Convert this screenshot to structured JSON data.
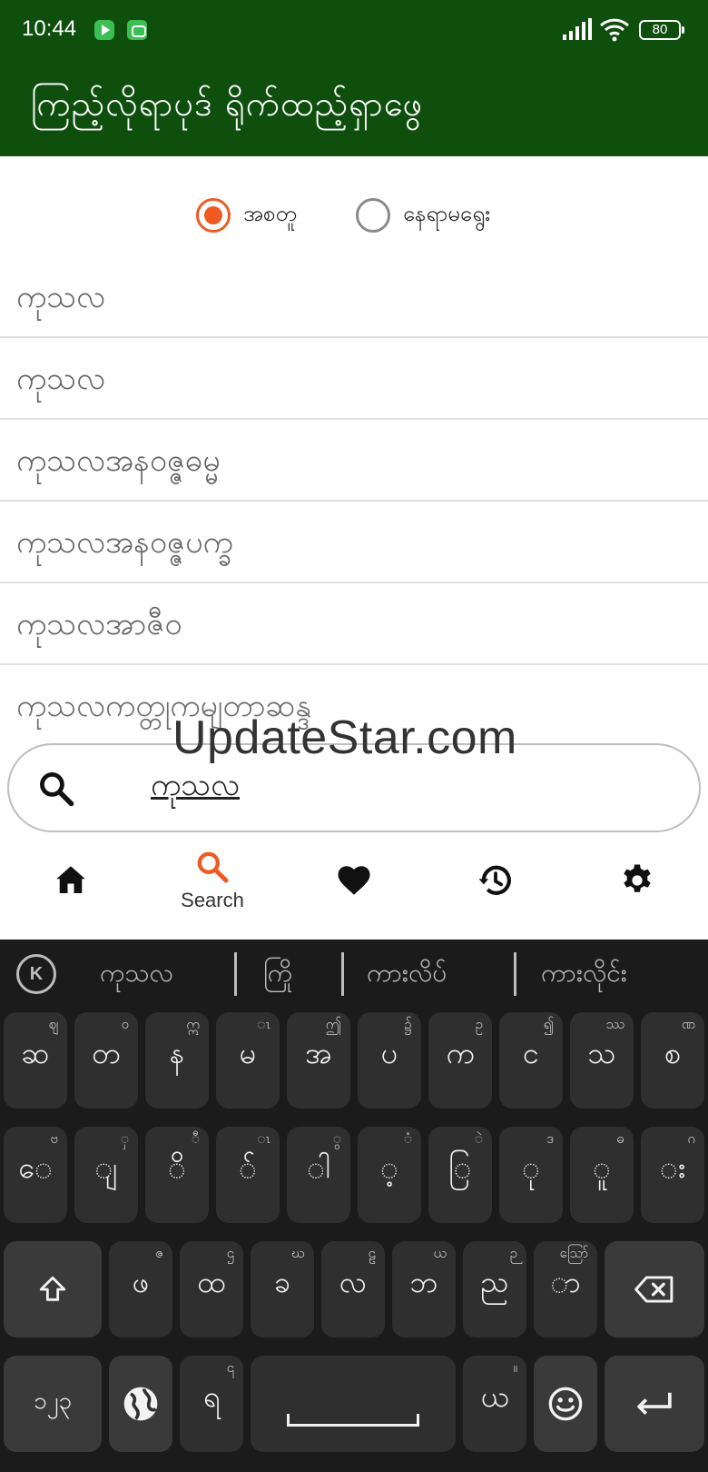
{
  "status_bar": {
    "time": "10:44",
    "battery": "80",
    "icons": [
      "play-app-icon",
      "bot-app-icon",
      "signal-icon",
      "wifi-icon",
      "battery-icon"
    ]
  },
  "app_bar": {
    "title": "ကြည့်လိုရာပုဒ် ရိုက်ထည့်ရှာဖွေ",
    "background": "#0f4f0e"
  },
  "search_mode": {
    "options": [
      {
        "label": "အစတူ",
        "selected": true
      },
      {
        "label": "နေရာမရွေး",
        "selected": false
      }
    ],
    "accent": "#ef5a23"
  },
  "results": [
    "ကုသလ",
    "ကုသလ",
    "ကုသလအနဝဇ္ဇဓမ္မ",
    "ကုသလအနဝဇ္ဇပက္ခ",
    "ကုသလအာဇီဝ",
    "ကုသလကတ္တုကမျတာဆန္ဒ"
  ],
  "watermark": "UpdateStar.com",
  "search": {
    "value": "ကုသလ",
    "icon": "search-icon"
  },
  "bottom_nav": [
    {
      "name": "home",
      "icon": "home-icon",
      "label": ""
    },
    {
      "name": "search",
      "icon": "search-icon",
      "label": "Search",
      "active": true
    },
    {
      "name": "favorites",
      "icon": "heart-icon",
      "label": ""
    },
    {
      "name": "history",
      "icon": "history-icon",
      "label": ""
    },
    {
      "name": "settings",
      "icon": "gear-icon",
      "label": ""
    }
  ],
  "keyboard": {
    "logo": "K",
    "suggestions": [
      "ကုသလ",
      "ကြို",
      "ကားလိပ်",
      "ကားလိုင်း"
    ],
    "row1": [
      {
        "main": "ဆ",
        "alt": "ဈ"
      },
      {
        "main": "တ",
        "alt": "ဝ"
      },
      {
        "main": "န",
        "alt": "ဣ"
      },
      {
        "main": "မ",
        "alt": "ၤ"
      },
      {
        "main": "အ",
        "alt": "ဤ"
      },
      {
        "main": "ပ",
        "alt": "၌"
      },
      {
        "main": "က",
        "alt": "ဥ"
      },
      {
        "main": "င",
        "alt": "၍"
      },
      {
        "main": "သ",
        "alt": "ဿ"
      },
      {
        "main": "စ",
        "alt": "ဏ"
      }
    ],
    "row2": [
      {
        "main": "ေ",
        "alt": "ဗ"
      },
      {
        "main": "ျ",
        "alt": "ှ"
      },
      {
        "main": "ိ",
        "alt": "ီ"
      },
      {
        "main": "်",
        "alt": "ၤ"
      },
      {
        "main": "ါ",
        "alt": "ွ"
      },
      {
        "main": "့",
        "alt": "ံ"
      },
      {
        "main": "ြ",
        "alt": "ဲ"
      },
      {
        "main": "ု",
        "alt": "ဒ"
      },
      {
        "main": "ူ",
        "alt": "ဓ"
      },
      {
        "main": "း",
        "alt": "ဂ"
      }
    ],
    "row3": [
      {
        "main": "ဖ",
        "alt": "ဇ"
      },
      {
        "main": "ထ",
        "alt": "ဌ"
      },
      {
        "main": "ခ",
        "alt": "ဃ"
      },
      {
        "main": "လ",
        "alt": "ဠ"
      },
      {
        "main": "ဘ",
        "alt": "ယ"
      },
      {
        "main": "ည",
        "alt": "ဉ"
      },
      {
        "main": "ာ",
        "alt": "ဪ"
      }
    ],
    "row4": {
      "numbers_label": "၁၂၃",
      "ra_key": {
        "main": "ရ",
        "alt": "၎"
      },
      "ya_key": {
        "main": "ယ",
        "alt": "။"
      }
    },
    "icons": [
      "shift-icon",
      "backspace-icon",
      "globe-icon",
      "emoji-icon",
      "enter-icon"
    ]
  }
}
